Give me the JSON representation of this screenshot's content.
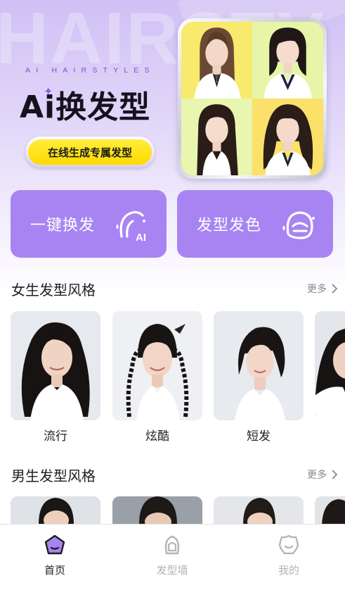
{
  "hero": {
    "watermark": "HAIRSTY",
    "tagline": "AI HAIRSTYLES",
    "title": "Ai换发型",
    "cta_label": "在线生成专属发型"
  },
  "features": [
    {
      "label": "一键换发",
      "icon": "ai-hair-swap-icon"
    },
    {
      "label": "发型发色",
      "icon": "hair-color-icon"
    }
  ],
  "female_section": {
    "title": "女生发型风格",
    "more": "更多",
    "items": [
      {
        "label": "流行"
      },
      {
        "label": "炫酷"
      },
      {
        "label": "短发"
      }
    ]
  },
  "male_section": {
    "title": "男生发型风格",
    "more": "更多"
  },
  "tabs": [
    {
      "label": "首页",
      "icon": "home-icon",
      "active": true
    },
    {
      "label": "发型墙",
      "icon": "hair-wall-icon",
      "active": false
    },
    {
      "label": "我的",
      "icon": "profile-icon",
      "active": false
    }
  ],
  "colors": {
    "accent": "#a884f3",
    "cta": "#ffe21a",
    "tab_active_icon": "#6a3fd0",
    "tab_inactive": "#b3b3b8"
  }
}
